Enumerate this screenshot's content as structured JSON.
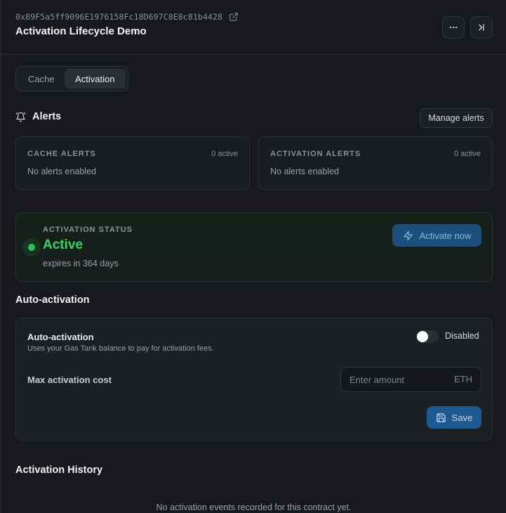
{
  "header": {
    "address": "0x89F5a5ff9096E1976158Fc18D697C8E8c81b4428",
    "title": "Activation Lifecycle Demo"
  },
  "tabs": [
    {
      "label": "Cache",
      "active": false
    },
    {
      "label": "Activation",
      "active": true
    }
  ],
  "alerts": {
    "title": "Alerts",
    "manage_label": "Manage alerts",
    "cards": [
      {
        "title": "CACHE ALERTS",
        "count": "0 active",
        "empty": "No alerts enabled"
      },
      {
        "title": "ACTIVATION ALERTS",
        "count": "0 active",
        "empty": "No alerts enabled"
      }
    ]
  },
  "status": {
    "label": "ACTIVATION STATUS",
    "value": "Active",
    "expiry": "expires in 364 days",
    "activate_label": "Activate now",
    "color": "#34d46a"
  },
  "auto_activation": {
    "section_title": "Auto-activation",
    "name": "Auto-activation",
    "description": "Uses your Gas Tank balance to pay for activation fees.",
    "toggle_state": "Disabled",
    "max_cost_label": "Max activation cost",
    "amount_placeholder": "Enter amount",
    "unit": "ETH",
    "save_label": "Save"
  },
  "history": {
    "title": "Activation History",
    "empty": "No activation events recorded for this contract yet."
  },
  "colors": {
    "accent": "#1d5a92",
    "status_green": "#22c55e",
    "background": "#17191d"
  },
  "icons": [
    "external-link-icon",
    "more-horizontal-icon",
    "collapse-panel-icon",
    "bell-icon",
    "zap-icon",
    "save-icon"
  ]
}
